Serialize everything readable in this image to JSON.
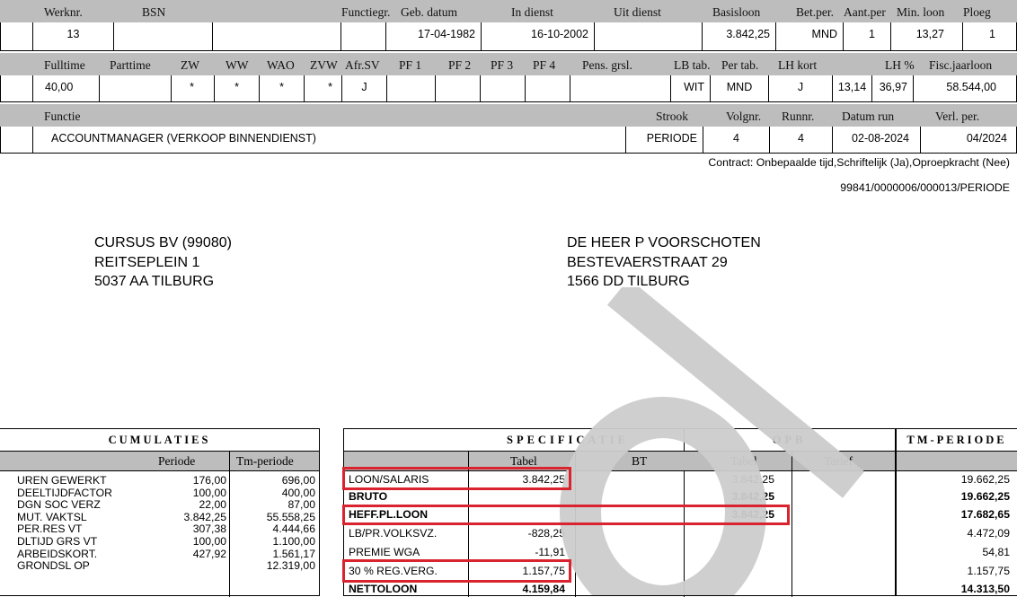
{
  "header1": {
    "labels": [
      "Werknr.",
      "BSN",
      "Functiegr.",
      "Geb. datum",
      "In dienst",
      "Uit dienst",
      "Basisloon",
      "Bet.per.",
      "Aant.per",
      "Min. loon",
      "Ploeg"
    ],
    "values": {
      "werknr": "13",
      "bsn": "",
      "functiegr": "",
      "geb_datum": "17-04-1982",
      "in_dienst": "16-10-2002",
      "uit_dienst": "",
      "basisloon": "3.842,25",
      "bet_per": "MND",
      "aant_per": "1",
      "min_loon": "13,27",
      "ploeg": "1"
    }
  },
  "header2": {
    "labels": [
      "Fulltime",
      "Parttime",
      "ZW",
      "WW",
      "WAO",
      "ZVW",
      "Afr.SV",
      "PF 1",
      "PF 2",
      "PF 3",
      "PF 4",
      "Pens. grsl.",
      "LB tab.",
      "Per tab.",
      "LH kort",
      "LH %",
      "Fisc.jaarloon"
    ],
    "values": {
      "fulltime": "40,00",
      "parttime": "",
      "zw": "*",
      "ww": "*",
      "wao": "*",
      "zvw": "*",
      "afr_sv": "J",
      "pf1": "",
      "pf2": "",
      "pf3": "",
      "pf4": "",
      "pens": "",
      "lb_tab": "WIT",
      "per_tab": "MND",
      "lh_kort": "J",
      "lh_kort_val": "13,14",
      "lh_pct": "36,97",
      "fisc": "58.544,00"
    }
  },
  "header3": {
    "labels": [
      "Functie",
      "Strook",
      "Volgnr.",
      "Runnr.",
      "Datum run",
      "Verl. per."
    ],
    "values": {
      "functie": "ACCOUNTMANAGER (VERKOOP BINNENDIENST)",
      "strook": "PERIODE",
      "volgnr": "4",
      "runnr": "4",
      "datum_run": "02-08-2024",
      "verl_per": "04/2024"
    }
  },
  "contract": "Contract: Onbepaalde tijd,Schriftelijk (Ja),Oproepkracht (Nee)",
  "reference": "99841/0000006/000013/PERIODE",
  "employer": [
    "CURSUS BV (99080)",
    "REITSEPLEIN 1",
    "5037 AA TILBURG"
  ],
  "employee": [
    "DE HEER P VOORSCHOTEN",
    "BESTEVAERSTRAAT 29",
    "1566 DD TILBURG"
  ],
  "cumulaties": {
    "title": "CUMULATIES",
    "col_periode": "Periode",
    "col_tm": "Tm-periode",
    "rows": [
      {
        "label": "UREN GEWERKT",
        "periode": "176,00",
        "tm": "696,00"
      },
      {
        "label": "DEELTIJDFACTOR",
        "periode": "100,00",
        "tm": "400,00"
      },
      {
        "label": "DGN SOC VERZ",
        "periode": "22,00",
        "tm": "87,00"
      },
      {
        "label": "MUT.  VAKTSL",
        "periode": "3.842,25",
        "tm": "55.558,25"
      },
      {
        "label": "PER.RES VT",
        "periode": "307,38",
        "tm": "4.444,66"
      },
      {
        "label": "DLTIJD GRS VT",
        "periode": "100,00",
        "tm": "1.100,00"
      },
      {
        "label": "ARBEIDSKORT.",
        "periode": "427,92",
        "tm": "1.561,17"
      },
      {
        "label": "GRONDSL OP",
        "periode": "",
        "tm": "12.319,00"
      }
    ]
  },
  "specificatie": {
    "title_left": "SPECIFICATIE",
    "title_right": "OPB",
    "title_tm": "TM-PERIODE",
    "col_tabel": "Tabel",
    "col_tabel2": "Tabel",
    "col_bt": "BT",
    "col_tarief": "Tarief",
    "rows": [
      {
        "label": "LOON/SALARIS",
        "tabel": "3.842,25",
        "opb": "3.842,25",
        "tm": "19.662,25",
        "bold": false
      },
      {
        "label": "BRUTO",
        "tabel": "",
        "opb": "3.842,25",
        "tm": "19.662,25",
        "bold": true
      },
      {
        "label": "HEFF.PL.LOON",
        "tabel": "",
        "opb": "3.842,25",
        "tm": "17.682,65",
        "bold": true
      },
      {
        "label": "LB/PR.VOLKSVZ.",
        "tabel": "-828,25",
        "opb": "",
        "tm": "4.472,09",
        "bold": false
      },
      {
        "label": "PREMIE WGA",
        "tabel": "-11,91",
        "opb": "",
        "tm": "54,81",
        "bold": false
      },
      {
        "label": "30 % REG.VERG.",
        "tabel": "1.157,75",
        "opb": "",
        "tm": "1.157,75",
        "bold": false
      },
      {
        "label": "NETTOLOON",
        "tabel": "4.159,84",
        "opb": "",
        "tm": "14.313,50",
        "bold": true
      }
    ]
  },
  "watermark_color": "#cccccc",
  "highlight_color": "#d9232e"
}
